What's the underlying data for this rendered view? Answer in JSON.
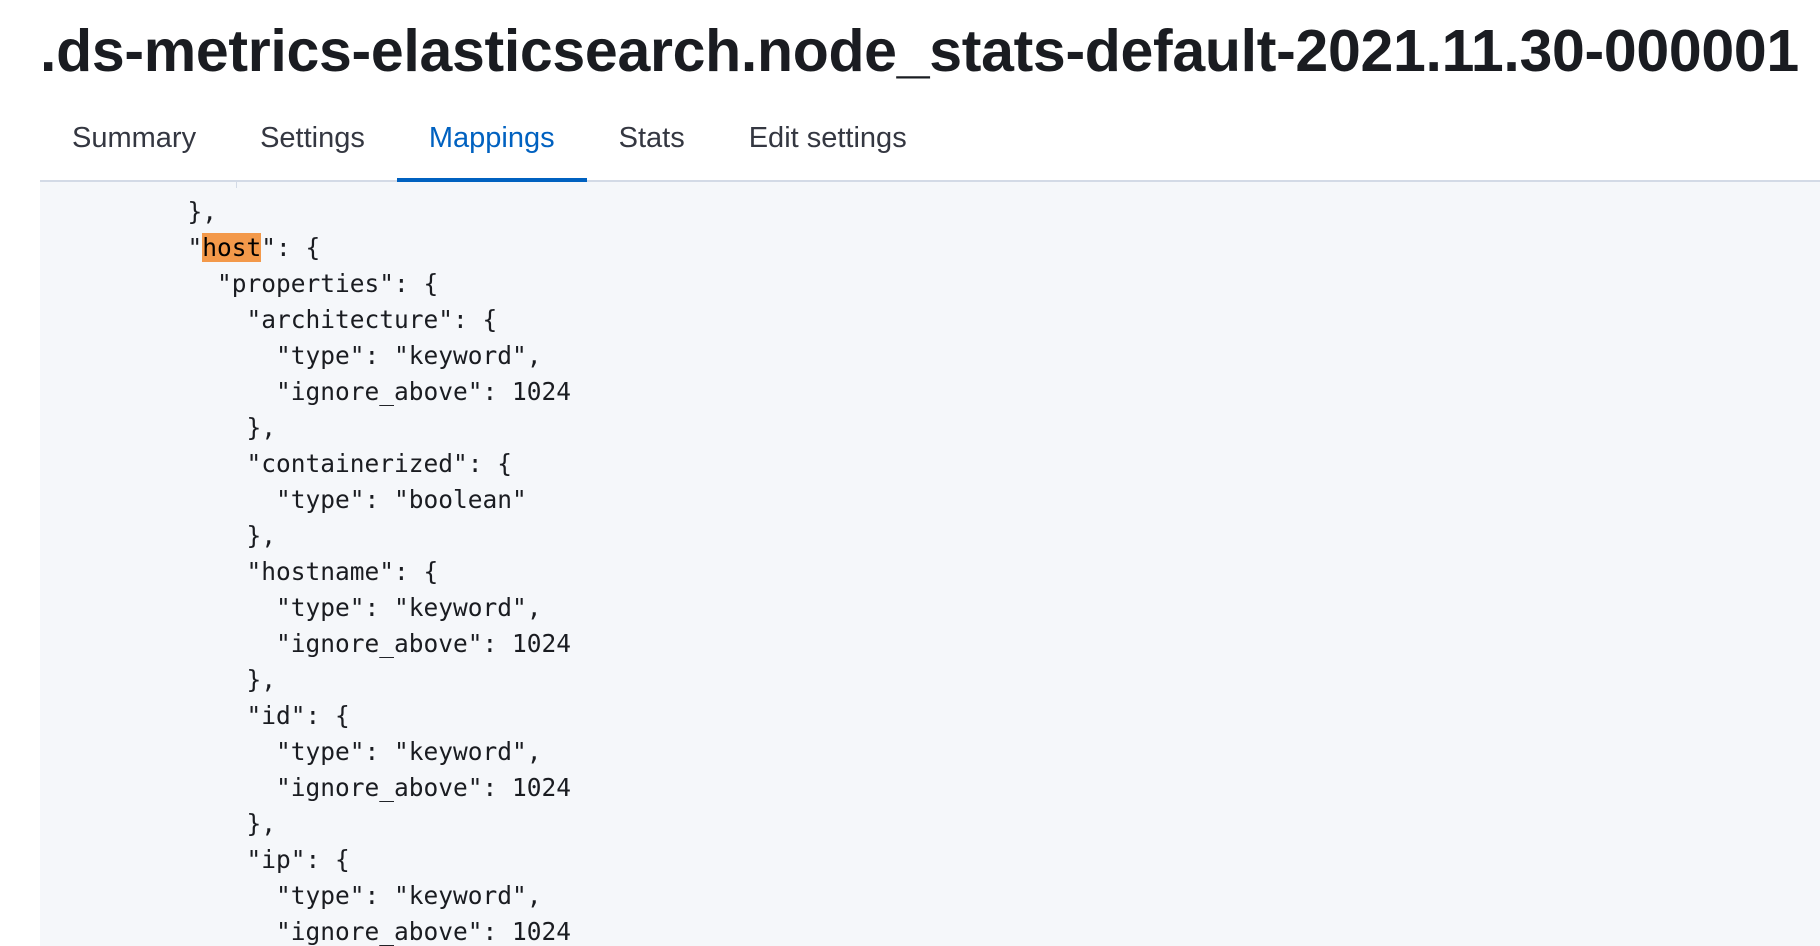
{
  "header": {
    "title": ".ds-metrics-elasticsearch.node_stats-default-2021.11.30-000001"
  },
  "tabs": [
    {
      "label": "Summary",
      "active": false
    },
    {
      "label": "Settings",
      "active": false
    },
    {
      "label": "Mappings",
      "active": true
    },
    {
      "label": "Stats",
      "active": false
    },
    {
      "label": "Edit settings",
      "active": false
    }
  ],
  "code": {
    "highlight_term": "host",
    "lines": [
      "          },",
      "          \"",
      "            \"properties\": {",
      "              \"architecture\": {",
      "                \"type\": \"keyword\",",
      "                \"ignore_above\": 1024",
      "              },",
      "              \"containerized\": {",
      "                \"type\": \"boolean\"",
      "              },",
      "              \"hostname\": {",
      "                \"type\": \"keyword\",",
      "                \"ignore_above\": 1024",
      "              },",
      "              \"id\": {",
      "                \"type\": \"keyword\",",
      "                \"ignore_above\": 1024",
      "              },",
      "              \"ip\": {",
      "                \"type\": \"keyword\",",
      "                \"ignore_above\": 1024"
    ],
    "highlight_line_suffix": "\": {"
  },
  "colors": {
    "accent": "#0061c0",
    "highlight": "#f3994a",
    "code_background": "#f5f7fa"
  }
}
